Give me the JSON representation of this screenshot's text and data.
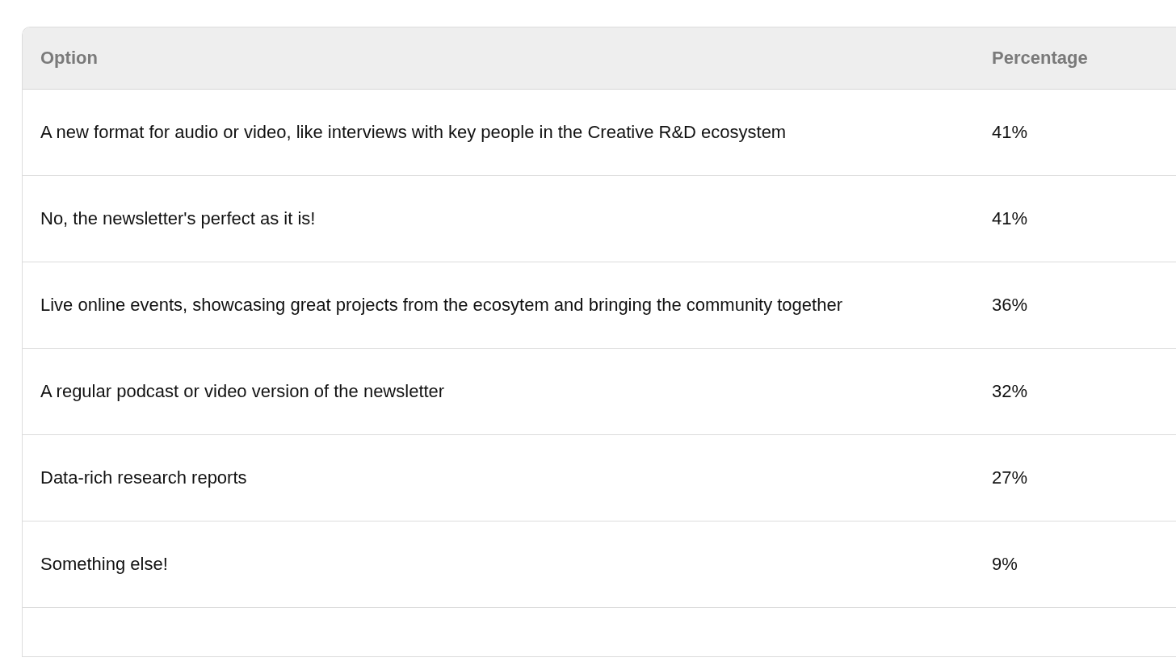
{
  "table": {
    "columns": [
      "Option",
      "Percentage"
    ],
    "rows": [
      {
        "option": "A new format for audio or video, like interviews with key people in the Creative R&D ecosystem",
        "percentage": "41%"
      },
      {
        "option": "No, the newsletter's perfect as it is!",
        "percentage": "41%"
      },
      {
        "option": "Live online events, showcasing great projects from the ecosytem and bringing the community together",
        "percentage": "36%"
      },
      {
        "option": "A regular podcast or video version of the newsletter",
        "percentage": "32%"
      },
      {
        "option": "Data-rich research reports",
        "percentage": "27%"
      },
      {
        "option": "Something else!",
        "percentage": "9%"
      }
    ]
  }
}
